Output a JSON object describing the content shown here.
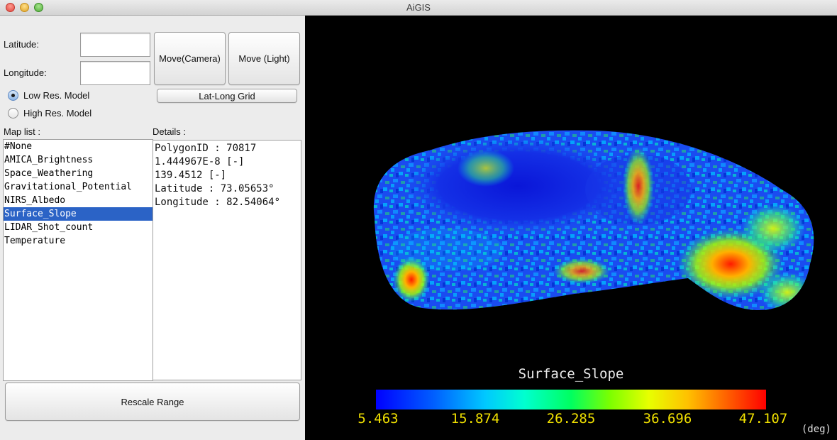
{
  "window": {
    "title": "AiGIS"
  },
  "coords": {
    "latitude_label": "Latitude:",
    "longitude_label": "Longitude:",
    "latitude_value": "",
    "longitude_value": ""
  },
  "buttons": {
    "move_camera": "Move(Camera)",
    "move_light": "Move (Light)",
    "latlong_grid": "Lat-Long Grid",
    "rescale": "Rescale Range"
  },
  "model": {
    "low_res": "Low Res. Model",
    "high_res": "High Res. Model",
    "selected": "low_res"
  },
  "map_list": {
    "label": "Map list :",
    "items": [
      "#None",
      "AMICA_Brightness",
      "Space_Weathering",
      "Gravitational_Potential",
      "NIRS_Albedo",
      "Surface_Slope",
      "LIDAR_Shot_count",
      "Temperature"
    ],
    "selected_index": 5
  },
  "details": {
    "label": "Details :",
    "lines": [
      "PolygonID : 70817",
      "1.444967E-8 [-]",
      "139.4512 [-]",
      "Latitude : 73.05653°",
      "Longitude : 82.54064°"
    ]
  },
  "viewer": {
    "map_title": "Surface_Slope",
    "scale_ticks": [
      "5.463",
      "15.874",
      "26.285",
      "36.696",
      "47.107"
    ],
    "unit": "(deg)",
    "colormap": [
      "#0000ff",
      "#00c8ff",
      "#00ff60",
      "#e8ff00",
      "#ff0000"
    ]
  }
}
